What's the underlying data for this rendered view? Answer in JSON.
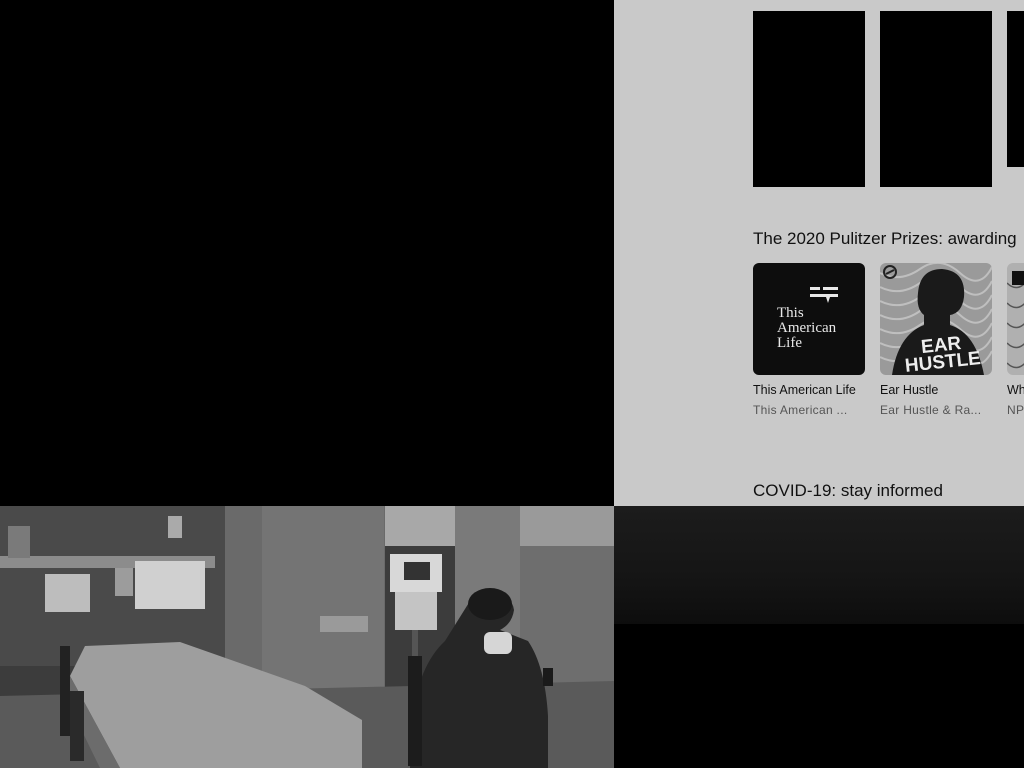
{
  "sections": {
    "pulitzer_title": "The 2020 Pulitzer Prizes: awarding",
    "covid_title": "COVID-19: stay informed"
  },
  "podcasts": [
    {
      "title": "This American Life",
      "publisher": "This American ...",
      "art_text": "This American Life"
    },
    {
      "title": "Ear Hustle",
      "publisher": "Ear Hustle & Ra...",
      "art_text": "EAR HUSTLE"
    },
    {
      "title": "Wh",
      "publisher": "NP"
    }
  ]
}
